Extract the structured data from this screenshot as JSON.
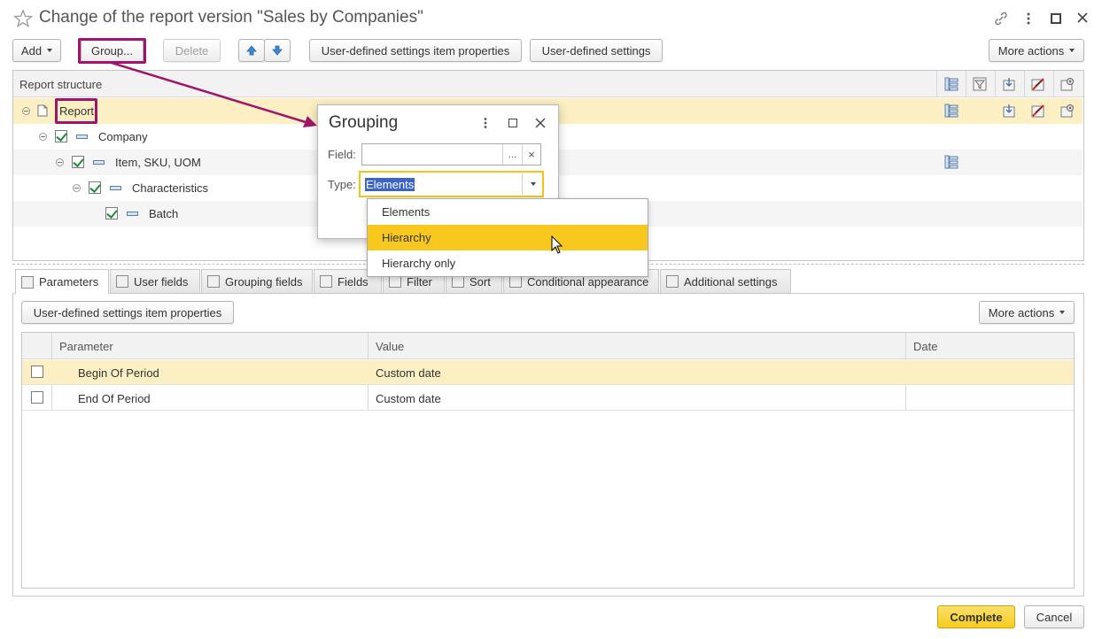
{
  "window": {
    "title": "Change of the report version \"Sales by Companies\"",
    "star_icon": "star-icon",
    "link_icon": "link-icon",
    "menu_icon": "kebab-icon",
    "maximize_icon": "maximize-icon",
    "close_icon": "close-icon"
  },
  "toolbar": {
    "add_label": "Add",
    "group_label": "Group...",
    "delete_label": "Delete",
    "item_properties_label": "User-defined settings item properties",
    "user_settings_label": "User-defined settings",
    "more_actions_label": "More actions"
  },
  "structure": {
    "header": "Report structure",
    "rows": [
      {
        "label": "Report",
        "icon": "report-icon",
        "checked": null,
        "selected": true
      },
      {
        "label": "Company",
        "icon": "grouping-icon",
        "checked": true
      },
      {
        "label": "Item, SKU, UOM",
        "icon": "grouping-icon",
        "checked": true
      },
      {
        "label": "Characteristics",
        "icon": "grouping-icon",
        "checked": true
      },
      {
        "label": "Batch",
        "icon": "grouping-icon",
        "checked": true
      }
    ]
  },
  "dialog": {
    "title": "Grouping",
    "field_label": "Field:",
    "field_value": "",
    "select_button": "...",
    "clear_button": "×",
    "type_label": "Type:",
    "type_value": "Elements",
    "options": [
      "Elements",
      "Hierarchy",
      "Hierarchy only"
    ],
    "highlighted_option": "Hierarchy"
  },
  "tabs": [
    "Parameters",
    "User fields",
    "Grouping fields",
    "Fields",
    "Filter",
    "Sort",
    "Conditional appearance",
    "Additional settings"
  ],
  "params": {
    "item_properties_label": "User-defined settings item properties",
    "more_actions_label": "More actions",
    "columns": {
      "parameter": "Parameter",
      "value": "Value",
      "date": "Date"
    },
    "rows": [
      {
        "parameter": "Begin Of Period",
        "value": "Custom date",
        "date": ""
      },
      {
        "parameter": "End Of Period",
        "value": "Custom date",
        "date": ""
      }
    ]
  },
  "footer": {
    "complete_label": "Complete",
    "cancel_label": "Cancel"
  },
  "colors": {
    "accent_yellow": "#f8d030",
    "selection_row": "#fcefc3",
    "annotation": "#a0146b",
    "dropdown_highlight": "#f9c81e"
  }
}
